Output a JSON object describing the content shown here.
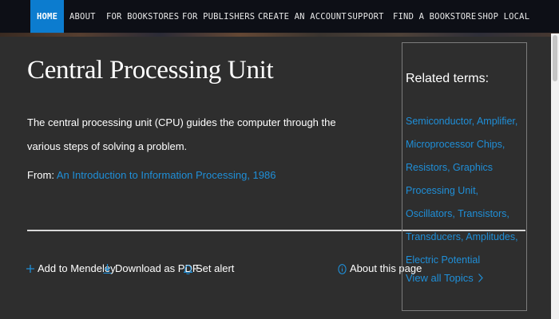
{
  "nav": {
    "items": [
      {
        "label": "HOME",
        "active": true
      },
      {
        "label": "ABOUT"
      },
      {
        "label": "FOR BOOKSTORES"
      },
      {
        "label": "FOR PUBLISHERS"
      },
      {
        "label": "CREATE AN ACCOUNT"
      },
      {
        "label": "SUPPORT"
      },
      {
        "label": "FIND A BOOKSTORE"
      },
      {
        "label": "SHOP LOCAL"
      }
    ]
  },
  "main": {
    "title": "Central Processing Unit",
    "description": "The central processing unit (CPU) guides the computer through the various steps of solving a problem.",
    "from_label": "From:",
    "from_link": "An Introduction to Information Processing, 1986",
    "actions": {
      "add_label": "Add to Mendeley",
      "download_label": "Download as PDF",
      "alert_label": "Set alert",
      "about_label": "About this page"
    }
  },
  "sidebar": {
    "heading": "Related terms:",
    "terms": "Semiconductor, Amplifier, Microprocessor Chips, Resistors, Graphics Processing Unit, Oscillators, Transistors, Transducers, Amplitudes, Electric Potential",
    "view_all": "View all Topics"
  },
  "colors": {
    "accent": "#1f8fd8",
    "nav_active": "#0c7ccf",
    "background": "#2e2e2e",
    "nav_background": "#0d0f16"
  },
  "icons": {
    "add": "plus-icon",
    "download": "download-icon",
    "alert": "bell-icon",
    "about": "info-icon",
    "view_all": "chevron-right-icon"
  }
}
